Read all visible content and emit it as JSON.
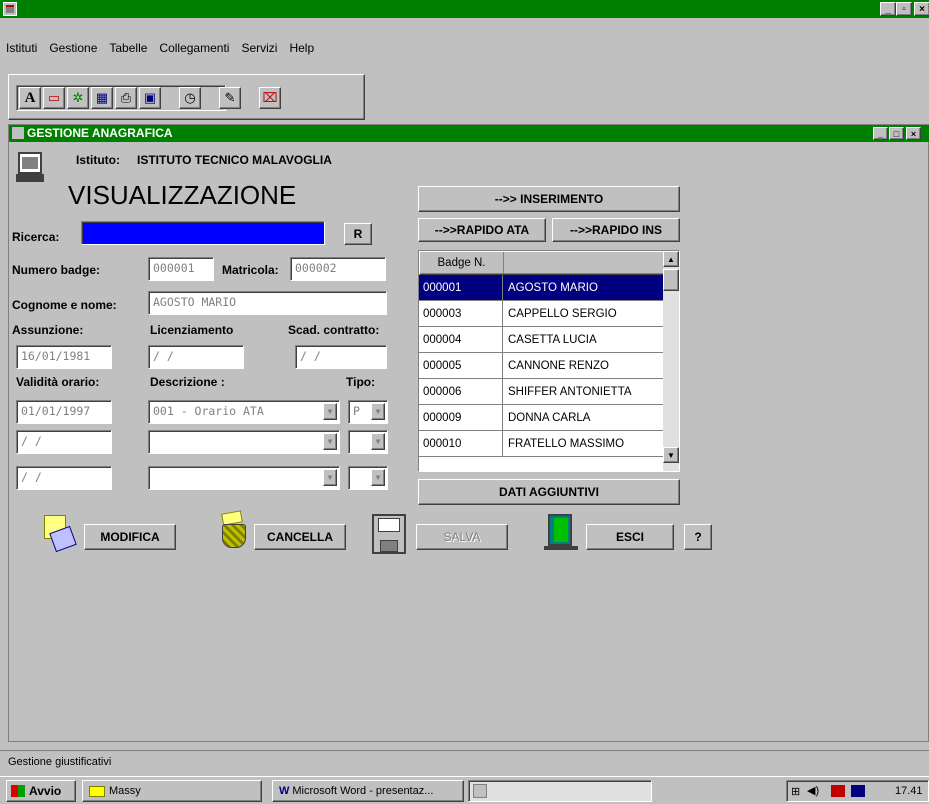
{
  "app": {
    "menu": [
      "Istituti",
      "Gestione",
      "Tabelle",
      "Collegamenti",
      "Servizi",
      "Help"
    ],
    "window_controls": [
      "_",
      "▫",
      "×"
    ]
  },
  "child": {
    "title": "GESTIONE ANAGRAFICA",
    "institute_label": "Istituto:",
    "institute_name": "ISTITUTO TECNICO MALAVOGLIA",
    "mode": "VISUALIZZAZIONE"
  },
  "form": {
    "ricerca_label": "Ricerca:",
    "ricerca_value": "",
    "r_button": "R",
    "badge_label": "Numero badge:",
    "badge_value": "000001",
    "matricola_label": "Matricola:",
    "matricola_value": "000002",
    "nome_label": "Cognome e nome:",
    "nome_value": "AGOSTO MARIO",
    "assunzione_label": "Assunzione:",
    "licenziamento_label": "Licenziamento",
    "scadenza_label": "Scad. contratto:",
    "assunzione_value": "16/01/1981",
    "licenziamento_value": "/ /",
    "scadenza_value": "/ /",
    "validita_label": "Validità orario:",
    "descrizione_label": "Descrizione :",
    "tipo_label": "Tipo:",
    "orari": [
      {
        "date": "01/01/1997",
        "descr": "001 - Orario ATA",
        "tipo": "P"
      },
      {
        "date": "/ /",
        "descr": "",
        "tipo": ""
      },
      {
        "date": "/ /",
        "descr": "",
        "tipo": ""
      }
    ]
  },
  "right_panel": {
    "inserimento": "-->> INSERIMENTO",
    "rapido_ata": "-->>RAPIDO ATA",
    "rapido_ins": "-->>RAPIDO INS",
    "col_badge": "Badge N.",
    "col_nome": "",
    "rows": [
      {
        "badge": "000001",
        "name": "AGOSTO MARIO"
      },
      {
        "badge": "000003",
        "name": "CAPPELLO SERGIO"
      },
      {
        "badge": "000004",
        "name": "CASETTA LUCIA"
      },
      {
        "badge": "000005",
        "name": "CANNONE RENZO"
      },
      {
        "badge": "000006",
        "name": "SHIFFER ANTONIETTA"
      },
      {
        "badge": "000009",
        "name": "DONNA CARLA"
      },
      {
        "badge": "000010",
        "name": "FRATELLO MASSIMO"
      }
    ],
    "dati_aggiuntivi": "DATI AGGIUNTIVI"
  },
  "actions": {
    "modifica": "MODIFICA",
    "cancella": "CANCELLA",
    "salva": "SALVA",
    "esci": "ESCI",
    "help": "?"
  },
  "status": "Gestione giustificativi",
  "taskbar": {
    "start": "Avvio",
    "items": [
      "Massy",
      "Microsoft Word - presentaz..."
    ],
    "clock": "17.41"
  },
  "colors": {
    "titlebar": "#008000",
    "selection": "#000080",
    "search_field": "#0000ff"
  }
}
